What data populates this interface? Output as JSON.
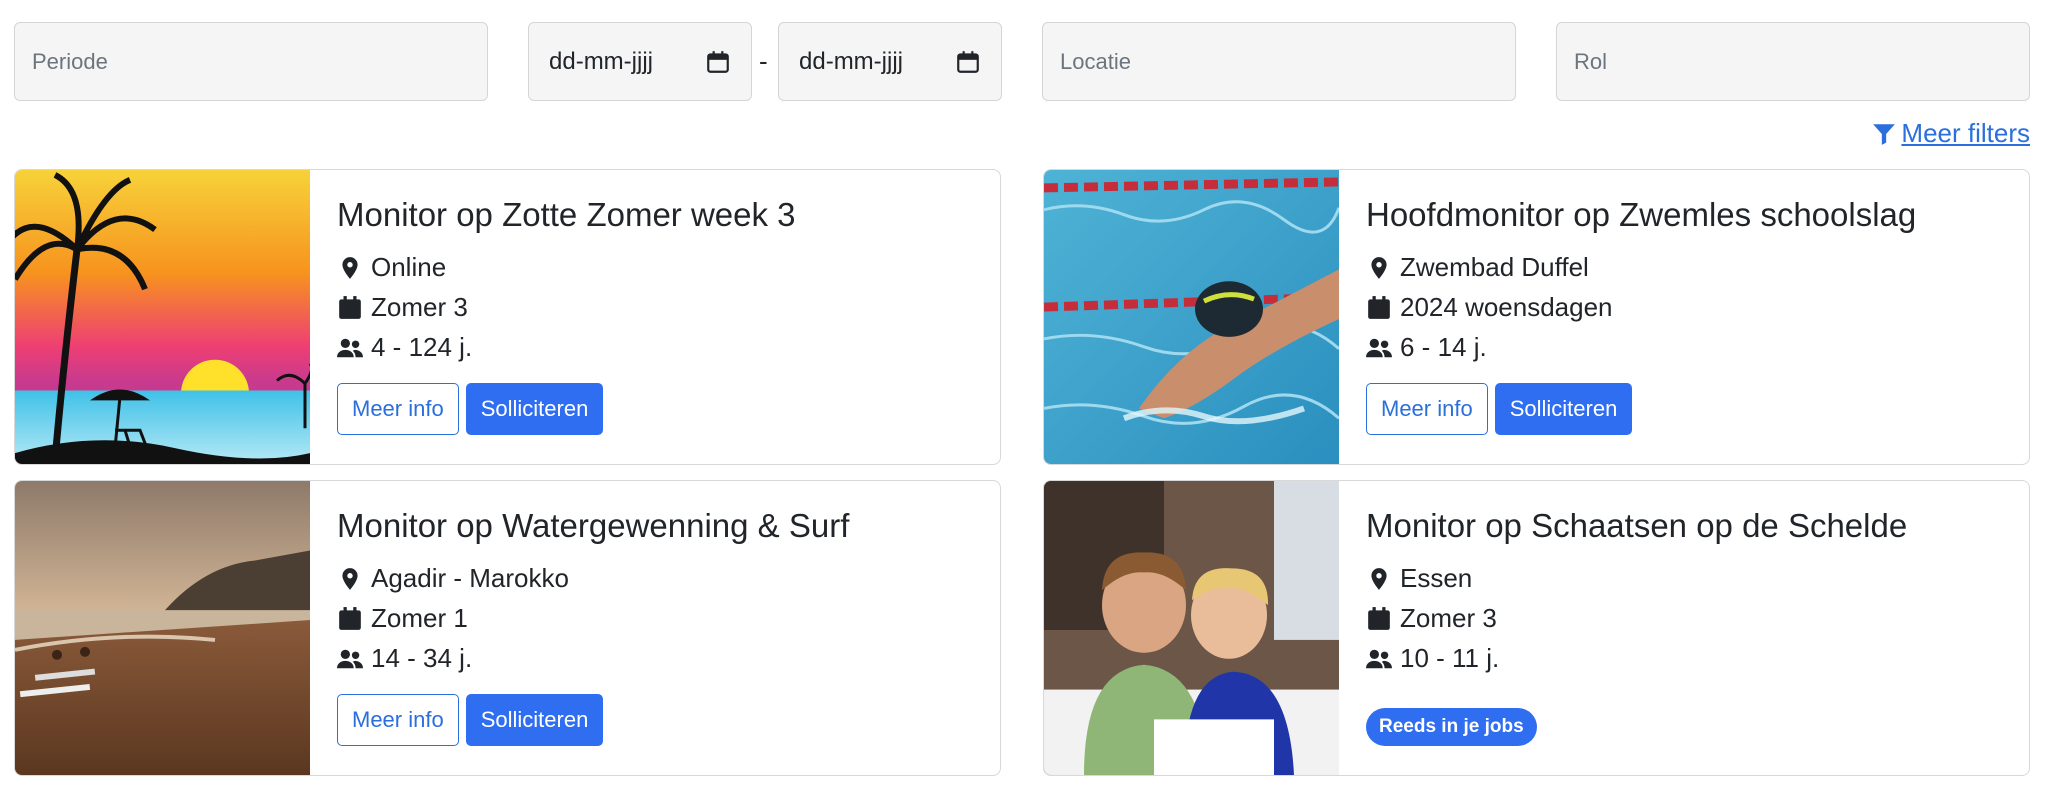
{
  "filters": {
    "periode_placeholder": "Periode",
    "date_from": "dd-mm-jjjj",
    "date_separator": "-",
    "date_to": "dd-mm-jjjj",
    "locatie_placeholder": "Locatie",
    "rol_placeholder": "Rol",
    "more_filters_label": "Meer filters"
  },
  "colors": {
    "accent": "#2f6ef0",
    "link": "#2a6fdb"
  },
  "cards": [
    {
      "title": "Monitor op Zotte Zomer week 3",
      "location": "Online",
      "period": "Zomer 3",
      "ages": "4 - 124 j.",
      "more_info": "Meer info",
      "apply": "Solliciteren",
      "image": "beach-sunset-palm"
    },
    {
      "title": "Hoofdmonitor op Zwemles schoolslag",
      "location": "Zwembad Duffel",
      "period": "2024 woensdagen",
      "ages": "6 - 14 j.",
      "more_info": "Meer info",
      "apply": "Solliciteren",
      "image": "swimmer-pool"
    },
    {
      "title": "Monitor op Watergewenning & Surf",
      "location": "Agadir - Marokko",
      "period": "Zomer 1",
      "ages": "14 - 34 j.",
      "more_info": "Meer info",
      "apply": "Solliciteren",
      "image": "beach-coast-dusk"
    },
    {
      "title": "Monitor op Schaatsen op de Schelde",
      "location": "Essen",
      "period": "Zomer 3",
      "ages": "10 - 11 j.",
      "badge": "Reeds in je jobs",
      "image": "kids-studying"
    }
  ],
  "icons": [
    "calendar-icon",
    "filter-icon",
    "map-pin-icon",
    "calendar-icon",
    "users-icon"
  ]
}
